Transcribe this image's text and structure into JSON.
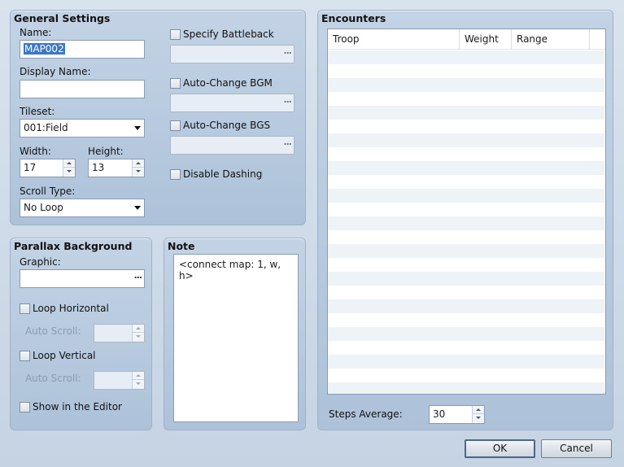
{
  "general": {
    "title": "General Settings",
    "name_label": "Name:",
    "name_value": "MAP002",
    "display_name_label": "Display Name:",
    "display_name_value": "",
    "tileset_label": "Tileset:",
    "tileset_value": "001:Field",
    "width_label": "Width:",
    "width_value": "17",
    "height_label": "Height:",
    "height_value": "13",
    "scroll_type_label": "Scroll Type:",
    "scroll_type_value": "No Loop",
    "specify_battleback_label": "Specify Battleback",
    "auto_change_bgm_label": "Auto-Change BGM",
    "auto_change_bgs_label": "Auto-Change BGS",
    "disable_dashing_label": "Disable Dashing",
    "ellipsis": "..."
  },
  "parallax": {
    "title": "Parallax Background",
    "graphic_label": "Graphic:",
    "graphic_value": "",
    "loop_horizontal_label": "Loop Horizontal",
    "loop_vertical_label": "Loop Vertical",
    "auto_scroll_label": "Auto Scroll:",
    "show_in_editor_label": "Show in the Editor",
    "ellipsis": "..."
  },
  "note": {
    "title": "Note",
    "text": "<connect map: 1, w, h>"
  },
  "encounters": {
    "title": "Encounters",
    "columns": [
      "Troop",
      "Weight",
      "Range"
    ],
    "steps_average_label": "Steps Average:",
    "steps_average_value": "30"
  },
  "buttons": {
    "ok": "OK",
    "cancel": "Cancel"
  }
}
